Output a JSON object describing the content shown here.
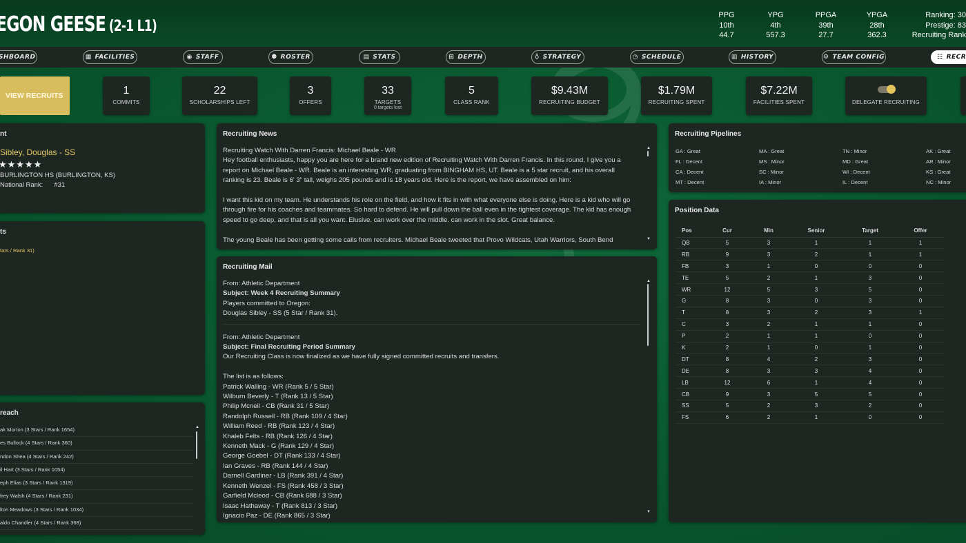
{
  "header": {
    "team_name": "EGON GEESE",
    "record": "(2-1 L1)",
    "stats": [
      {
        "label": "PPG",
        "rank": "10th",
        "value": "44.7"
      },
      {
        "label": "YPG",
        "rank": "4th",
        "value": "557.3"
      },
      {
        "label": "PPGA",
        "rank": "39th",
        "value": "27.7"
      },
      {
        "label": "YPGA",
        "rank": "28th",
        "value": "362.3"
      }
    ],
    "ranking_line": "Ranking: 30",
    "prestige_line": "Prestige: 83",
    "recruiting_rank_line": "Recruiting Rank"
  },
  "nav": {
    "items": [
      {
        "label": "ASHBOARD",
        "icon": "dashboard-icon",
        "glyph": ""
      },
      {
        "label": "FACILITIES",
        "icon": "stadium-icon",
        "glyph": "▦"
      },
      {
        "label": "STAFF",
        "icon": "person-icon",
        "glyph": "◉"
      },
      {
        "label": "ROSTER",
        "icon": "people-icon",
        "glyph": "⚉"
      },
      {
        "label": "STATS",
        "icon": "table-icon",
        "glyph": "▤"
      },
      {
        "label": "DEPTH",
        "icon": "depth-chart-icon",
        "glyph": "⊞"
      },
      {
        "label": "STRATEGY",
        "icon": "lightbulb-icon",
        "glyph": "♁"
      },
      {
        "label": "SCHEDULE",
        "icon": "clock-icon",
        "glyph": "◷"
      },
      {
        "label": "HISTORY",
        "icon": "scroll-icon",
        "glyph": "▥"
      },
      {
        "label": "TEAM CONFIG",
        "icon": "gear-icon",
        "glyph": "⚙"
      },
      {
        "label": "RECRU",
        "icon": "sliders-icon",
        "glyph": "☷"
      }
    ]
  },
  "summary": {
    "view_recruits_label": "VIEW RECRUITS",
    "cards": [
      {
        "value": "1",
        "label": "COMMITS"
      },
      {
        "value": "22",
        "label": "SCHOLARSHIPS LEFT"
      },
      {
        "value": "3",
        "label": "OFFERS"
      },
      {
        "value": "33",
        "label": "TARGETS",
        "sub": "0 targets lost"
      },
      {
        "value": "5",
        "label": "CLASS RANK"
      },
      {
        "value": "$9.43M",
        "label": "RECRUITING BUDGET"
      },
      {
        "value": "$1.79M",
        "label": "RECRUITING SPENT"
      },
      {
        "value": "$7.22M",
        "label": "FACILITIES SPENT"
      }
    ],
    "delegate_label": "DELEGATE RECRUITING",
    "delegate_on": true
  },
  "left": {
    "panel1_title": "nt",
    "recruit_name": "Sibley, Douglas - SS",
    "stars": "★★★★★",
    "school": "BURLINGTON HS (BURLINGTON, KS)",
    "national_rank_label": "National Rank:",
    "national_rank_value": "#31",
    "panel2_title": "ts",
    "commit_line": "tars / Rank 31)",
    "panel3_title": "reach",
    "outreach": [
      "ak Morton (3 Stars / Rank 1654)",
      "es Bullock (4 Stars / Rank 360)",
      "ndon Shea (4 Stars / Rank 242)",
      "il Hart (3 Stars / Rank 1054)",
      "eph Elias (3 Stars / Rank 1319)",
      "frey Walsh (4 Stars / Rank 231)",
      "lton Meadows (3 Stars / Rank 1034)",
      "aldo Chandler (4 Stars / Rank 368)"
    ]
  },
  "news": {
    "title": "Recruiting News",
    "headline": "Recruiting Watch With Darren Francis: Michael Beale - WR",
    "lines1": [
      "Hey football enthusiasts, happy you are here for a brand new edition of Recruiting Watch With Darren Francis. In this round, I give you a",
      "report on Michael Beale - WR. Beale is an interesting WR, graduating from BINGHAM HS, UT. Beale is a 5 star recruit, and his overall",
      "ranking is 23. Beale is 6' 3\" tall, weighs 205 pounds and is 18 years old. Here is the report, we have assembled on him:"
    ],
    "lines2": [
      "I want this kid on my team. He understands his role on the field, and how it fits in with what everyone else is doing. Here is a kid who will go",
      "through fire for his coaches and teammates. So hard to defend. He will pull down the ball even in the tightest coverage. The kid has enough",
      "speed to go deep, and that is all you want. Elusive. can work over the middle. can work in the slot. Great balance."
    ],
    "line3": "The young Beale has been getting some calls from recruiters. Michael Beale tweeted that Provo Wildcats, Utah Warriors, South Bend"
  },
  "mail": {
    "title": "Recruiting Mail",
    "m1_from": "From: Athletic Department",
    "m1_subject": "Subject: Week 4 Recruiting Summary",
    "m1_line1": "Players committed to Oregon:",
    "m1_line2": "Douglas Sibley - SS (5 Star / Rank 31).",
    "m2_from": "From: Athletic Department",
    "m2_subject": "Subject: Final Recruiting Period Summary",
    "m2_line1": "Our Recruiting Class is now finalized as we have fully signed committed recruits and transfers.",
    "m2_list_intro": "The list is as follows:",
    "m2_list": [
      "Patrick Walling - WR (Rank 5 / 5 Star)",
      "Wilburn Beverly - T (Rank 13 / 5 Star)",
      "Philip Mcneil - CB (Rank 31 / 5 Star)",
      "Randolph Russell - RB (Rank 109 / 4 Star)",
      "William Reed - RB (Rank 123 / 4 Star)",
      "Khaleb Felts - RB (Rank 126 / 4 Star)",
      "Kenneth Mack - G (Rank 129 / 4 Star)",
      "George Goebel - DT (Rank 133 / 4 Star)",
      "Ian Graves - RB (Rank 144 / 4 Star)",
      "Darnell Gardiner - LB (Rank 391 / 4 Star)",
      "Kenneth Wenzel - FS (Rank 458 / 3 Star)",
      "Garfield Mcleod - CB (Rank 688 / 3 Star)",
      "Isaac Hathaway - T (Rank 813 / 3 Star)",
      "Ignacio Paz - DE (Rank 865 / 3 Star)"
    ]
  },
  "pipelines": {
    "title": "Recruiting Pipelines",
    "items": [
      "GA : Great",
      "MA : Great",
      "TN : Minor",
      "AK : Great",
      "FL : Decent",
      "MS : Minor",
      "MD : Great",
      "AR : Minor",
      "CA : Decent",
      "SC : Minor",
      "WI : Decent",
      "KS : Great",
      "MT : Decent",
      "IA : Minor",
      "IL : Decent",
      "NC : Minor"
    ]
  },
  "position_data": {
    "title": "Position Data",
    "headers": [
      "Pos",
      "Cur",
      "Min",
      "Senior",
      "Target",
      "Offer"
    ],
    "rows": [
      [
        "QB",
        "5",
        "3",
        "1",
        "1",
        "1"
      ],
      [
        "RB",
        "9",
        "3",
        "2",
        "1",
        "1"
      ],
      [
        "FB",
        "3",
        "1",
        "0",
        "0",
        "0"
      ],
      [
        "TE",
        "5",
        "2",
        "1",
        "3",
        "0"
      ],
      [
        "WR",
        "12",
        "5",
        "3",
        "5",
        "0"
      ],
      [
        "G",
        "8",
        "3",
        "0",
        "3",
        "0"
      ],
      [
        "T",
        "8",
        "3",
        "2",
        "3",
        "1"
      ],
      [
        "C",
        "3",
        "2",
        "1",
        "1",
        "0"
      ],
      [
        "P",
        "2",
        "1",
        "1",
        "0",
        "0"
      ],
      [
        "K",
        "2",
        "1",
        "0",
        "1",
        "0"
      ],
      [
        "DT",
        "8",
        "4",
        "2",
        "3",
        "0"
      ],
      [
        "DE",
        "8",
        "3",
        "3",
        "4",
        "0"
      ],
      [
        "LB",
        "12",
        "6",
        "1",
        "4",
        "0"
      ],
      [
        "CB",
        "9",
        "3",
        "5",
        "5",
        "0"
      ],
      [
        "SS",
        "5",
        "2",
        "3",
        "2",
        "0"
      ],
      [
        "FS",
        "6",
        "2",
        "1",
        "0",
        "0"
      ]
    ]
  },
  "colors": {
    "accent_gold": "#d8bd5e",
    "panel_bg": "#1e2622",
    "background_green": "#0a5a30"
  }
}
